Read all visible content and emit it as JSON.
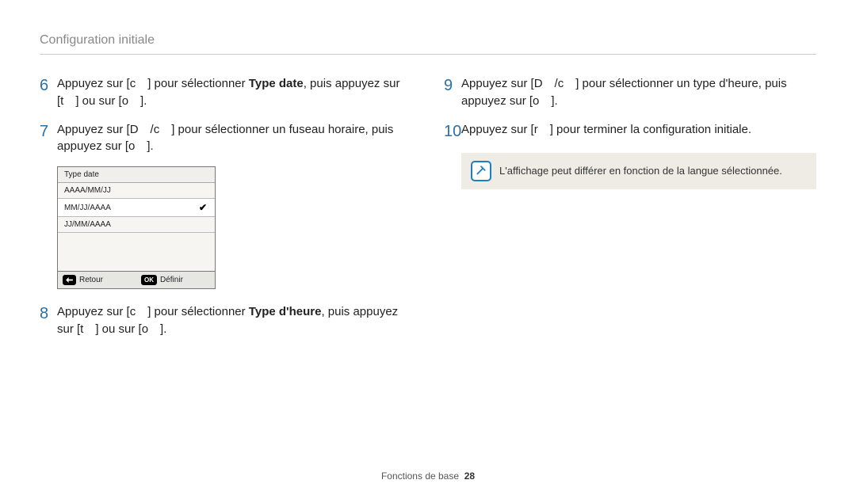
{
  "header": {
    "title": "Configuration initiale"
  },
  "left": {
    "step6": {
      "num": "6",
      "text_pre": "Appuyez sur [c ] pour sélectionner ",
      "text_bold": "Type date",
      "text_post": ", puis appuyez sur [t ] ou sur [o ]."
    },
    "step7": {
      "num": "7",
      "text": "Appuyez sur [D /c ] pour sélectionner un fuseau horaire, puis appuyez sur [o ]."
    },
    "lcd": {
      "title": "Type date",
      "rows": [
        "AAAA/MM/JJ",
        "MM/JJ/AAAA",
        "JJ/MM/AAAA"
      ],
      "selected_index": 1,
      "footer": {
        "back": "Retour",
        "ok_badge": "OK",
        "ok": "Définir"
      }
    },
    "step8": {
      "num": "8",
      "text_pre": "Appuyez sur [c ] pour sélectionner ",
      "text_bold": "Type d'heure",
      "text_post": ", puis appuyez sur [t ] ou sur [o ]."
    }
  },
  "right": {
    "step9": {
      "num": "9",
      "text": "Appuyez sur [D /c ] pour sélectionner un type d'heure, puis appuyez sur [o ]."
    },
    "step10": {
      "num": "10",
      "text": "Appuyez sur [r ] pour terminer la configuration initiale."
    },
    "note": "L'affichage peut différer en fonction de la langue sélectionnée."
  },
  "footer": {
    "section": "Fonctions de base",
    "page": "28"
  }
}
